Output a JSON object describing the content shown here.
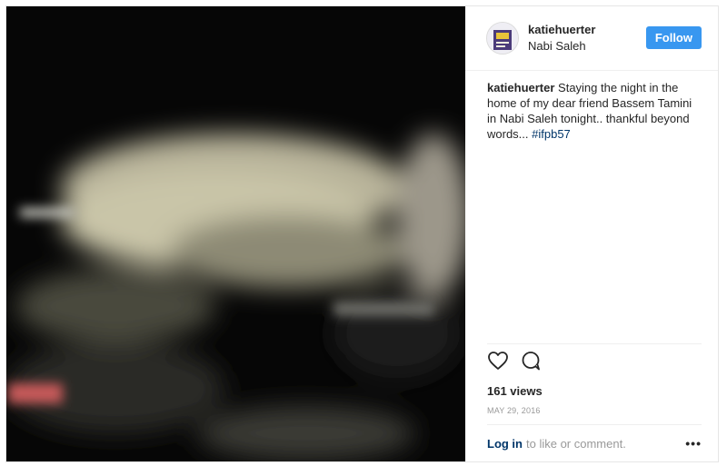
{
  "post": {
    "username": "katiehuerter",
    "location": "Nabi Saleh",
    "follow_label": "Follow",
    "caption_user": "katiehuerter",
    "caption_text": " Staying the night in the home of my dear friend Bassem Tamini in Nabi Saleh tonight.. thankful beyond words... ",
    "caption_hashtag": "#ifpb57",
    "views": "161 views",
    "date": "MAY 29, 2016",
    "login_label": "Log in",
    "login_rest": "to like or comment.",
    "more_label": "•••"
  },
  "icons": {
    "like": "heart-icon",
    "comment": "comment-icon"
  },
  "colors": {
    "follow_bg": "#3897f0",
    "link": "#003569"
  }
}
